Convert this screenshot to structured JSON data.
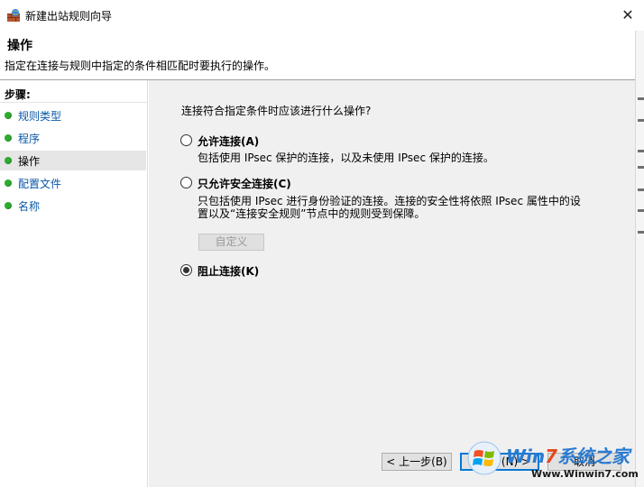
{
  "window": {
    "title": "新建出站规则向导",
    "close_glyph": "✕"
  },
  "header": {
    "title": "操作",
    "description": "指定在连接与规则中指定的条件相匹配时要执行的操作。"
  },
  "sidebar": {
    "label": "步骤:",
    "items": [
      {
        "label": "规则类型",
        "active": false
      },
      {
        "label": "程序",
        "active": false
      },
      {
        "label": "操作",
        "active": true
      },
      {
        "label": "配置文件",
        "active": false
      },
      {
        "label": "名称",
        "active": false
      }
    ]
  },
  "main": {
    "question": "连接符合指定条件时应该进行什么操作?",
    "options": [
      {
        "label": "允许连接(A)",
        "description": "包括使用 IPsec 保护的连接，以及未使用 IPsec 保护的连接。",
        "checked": false
      },
      {
        "label": "只允许安全连接(C)",
        "description_line1": "只包括使用 IPsec 进行身份验证的连接。连接的安全性将依照 IPsec 属性中的设",
        "description_line2": "置以及“连接安全规则”节点中的规则受到保障。",
        "checked": false
      },
      {
        "label": "阻止连接(K)",
        "checked": true
      }
    ],
    "custom_button": "自定义"
  },
  "footer": {
    "back": "< 上一步(B)",
    "next": "下一步(N) >",
    "cancel": "取消"
  },
  "watermark": {
    "brand_prefix": "Win",
    "brand_seven": "7",
    "brand_suffix": "系统之家",
    "url": "Www.Winwin7.com"
  },
  "colors": {
    "step_dot": "#2eac2e",
    "step_link": "#0a58a8",
    "pane_bg": "#f0f0f0",
    "default_button_border": "#0078d7"
  }
}
